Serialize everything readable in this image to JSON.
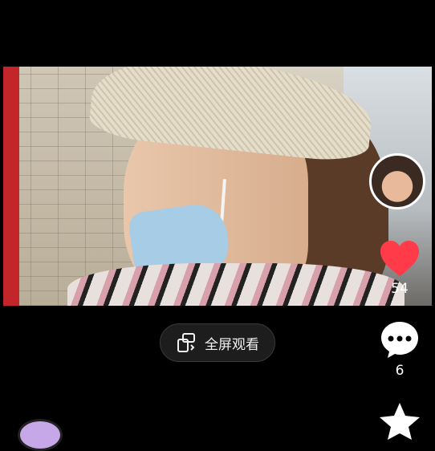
{
  "sidebar": {
    "like_count": "54",
    "comment_count": "6"
  },
  "fullscreen": {
    "label": "全屏观看"
  },
  "colors": {
    "heart": "#ff3b4a",
    "background": "#000000"
  },
  "icons": {
    "like": "heart-icon",
    "comment": "comment-icon",
    "favorite": "star-icon",
    "fullscreen": "rotate-screen-icon"
  }
}
